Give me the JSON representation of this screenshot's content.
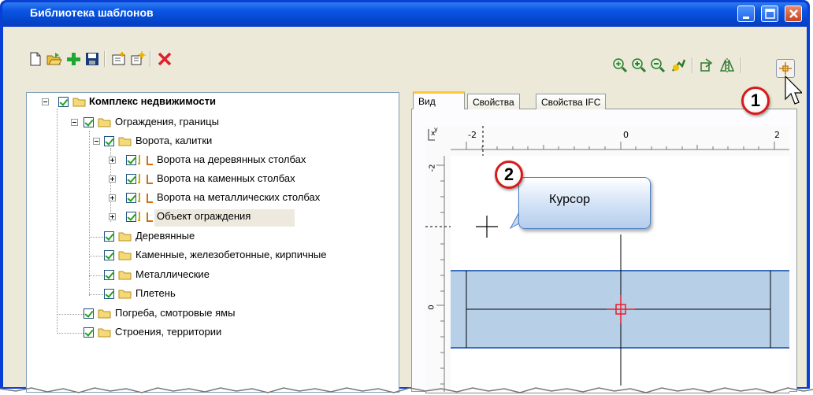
{
  "window": {
    "title": "Библиотека шаблонов"
  },
  "toolbar": {
    "left_icons": [
      "new-file-icon",
      "open-folder-icon",
      "add-plus-icon",
      "save-icon",
      "new-folder-icon",
      "properties-icon",
      "delete-icon"
    ],
    "right_icons": [
      "zoom-extents-icon",
      "zoom-in-icon",
      "zoom-out-icon",
      "pan-icon",
      "rotate-icon",
      "mirror-icon",
      "cursor-crosshair-icon"
    ]
  },
  "tree": {
    "root": "Комплекс недвижимости",
    "items": [
      {
        "label": "Ограждения, границы"
      },
      {
        "label": "Ворота, калитки"
      },
      {
        "label": "Ворота на деревянных столбах"
      },
      {
        "label": "Ворота на каменных столбах"
      },
      {
        "label": "Ворота на металлических столбах"
      },
      {
        "label": "Объект ограждения"
      },
      {
        "label": "Деревянные"
      },
      {
        "label": "Каменные, железобетонные, кирпичные"
      },
      {
        "label": "Металлические"
      },
      {
        "label": "Плетень"
      },
      {
        "label": "Погреба, смотровые ямы"
      },
      {
        "label": "Строения, территории"
      }
    ]
  },
  "tabs": [
    "Вид",
    "Свойства",
    "Свойства IFC"
  ],
  "ruler": {
    "top_labels": [
      "-2",
      "0",
      "2"
    ],
    "left_labels": [
      "-2",
      "0"
    ],
    "origin_x": "x",
    "origin_y": "y"
  },
  "callout": {
    "text": "Курсор"
  },
  "badges": [
    "1",
    "2"
  ],
  "colors": {
    "accent_fill": "#b8cfe8",
    "accent_line": "#3d6fbf",
    "cursor_red": "#e8202a",
    "badge_border": "#d71a1a"
  }
}
